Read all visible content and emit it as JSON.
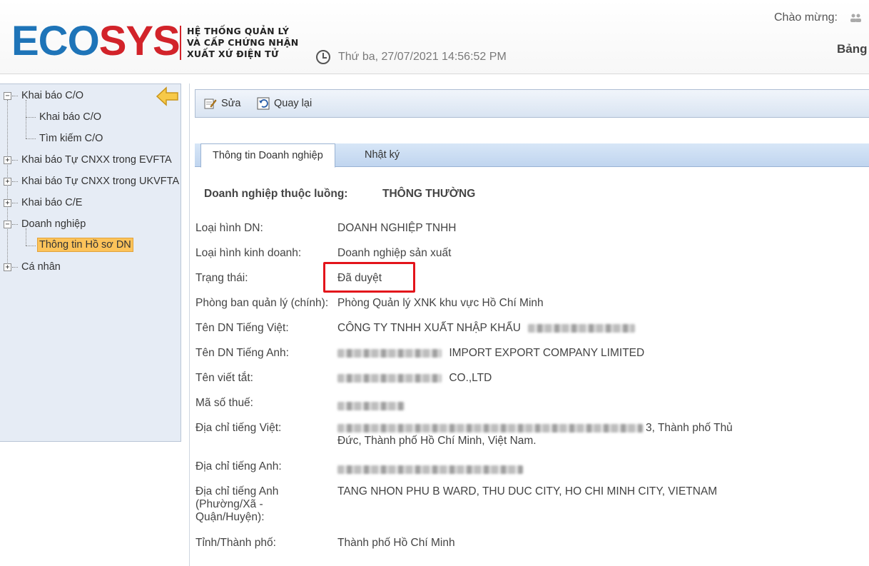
{
  "header": {
    "logo_part1": "ECO",
    "logo_part2": "SYS",
    "logo_sub_1": "HỆ THỐNG QUẢN LÝ",
    "logo_sub_2": "VÀ CẤP CHỨNG NHẬN",
    "logo_sub_3": "XUẤT XỨ ĐIỆN TỬ",
    "datetime": "Thứ ba, 27/07/2021 14:56:52 PM",
    "welcome": "Chào mừng:",
    "board": "Bảng"
  },
  "sidebar": {
    "items": [
      {
        "label": "Khai báo C/O"
      },
      {
        "label": "Khai báo C/O"
      },
      {
        "label": "Tìm kiếm C/O"
      },
      {
        "label": "Khai báo Tự CNXX trong EVFTA"
      },
      {
        "label": "Khai báo Tự CNXX trong UKVFTA"
      },
      {
        "label": "Khai báo C/E"
      },
      {
        "label": "Doanh nghiệp"
      },
      {
        "label": "Thông tin Hồ sơ DN"
      },
      {
        "label": "Cá nhân"
      }
    ]
  },
  "toolbar": {
    "edit_label": "Sửa",
    "back_label": "Quay lại"
  },
  "tabs": [
    {
      "label": "Thông tin Doanh nghiệp"
    },
    {
      "label": "Nhật ký"
    }
  ],
  "company": {
    "stream_label": "Doanh nghiệp thuộc luồng:",
    "stream_value": "THÔNG THƯỜNG",
    "fields": [
      {
        "label": "Loại hình DN:",
        "value": "DOANH NGHIỆP TNHH"
      },
      {
        "label": "Loại hình kinh doanh:",
        "value": "Doanh nghiệp sản xuất"
      },
      {
        "label": "Trạng thái:",
        "value": "Đã duyệt"
      },
      {
        "label": "Phòng ban quản lý (chính):",
        "value": "Phòng Quản lý XNK khu vực Hồ Chí Minh"
      },
      {
        "label": "Tên DN Tiếng Việt:",
        "value": "CÔNG TY TNHH XUẤT NHẬP KHẨU"
      },
      {
        "label": "Tên DN Tiếng Anh:",
        "value": "IMPORT EXPORT COMPANY LIMITED"
      },
      {
        "label": "Tên viết tắt:",
        "value": "CO.,LTD"
      },
      {
        "label": "Mã số thuế:",
        "value": ""
      },
      {
        "label": "Địa chỉ tiếng Việt:",
        "value": "3, Thành phố Thủ",
        "value2": "Đức, Thành phố Hồ Chí Minh, Việt Nam."
      },
      {
        "label": "Địa chỉ tiếng Anh:",
        "value": ""
      },
      {
        "label": "Địa chỉ tiếng Anh",
        "label2": "(Phường/Xã -",
        "label3": "Quận/Huyện):",
        "value": "TANG NHON PHU B WARD, THU DUC CITY, HO CHI MINH CITY, VIETNAM"
      },
      {
        "label": "Tỉnh/Thành phố:",
        "value": "Thành phố Hồ Chí Minh"
      }
    ]
  },
  "colors": {
    "logo_blue": "#1e74b8",
    "logo_red": "#d2232a",
    "highlight_box": "#e3141b",
    "selected_item": "#fcc35a",
    "sidebar_bg": "#e6ecf5"
  }
}
